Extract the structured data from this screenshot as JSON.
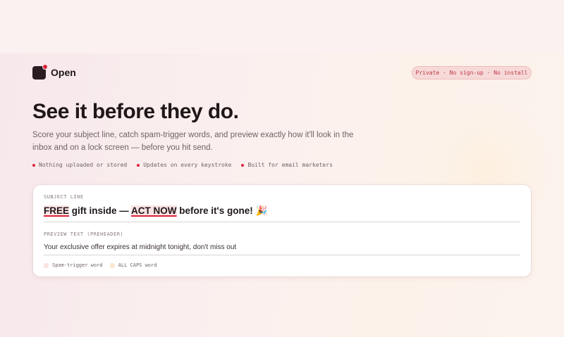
{
  "brand": {
    "name": "Open"
  },
  "badge": {
    "text": "Private · No sign-up · No install"
  },
  "hero": {
    "headline": "See it before they do.",
    "subtext": "Score your subject line, catch spam-trigger words, and preview exactly how it'll look in the inbox and on a lock screen — before you hit send."
  },
  "features": [
    "Nothing uploaded or stored",
    "Updates on every keystroke",
    "Built for email marketers"
  ],
  "form": {
    "subject_label": "SUBJECT LINE",
    "subject_parts": {
      "p1": "FREE",
      "p2": " gift inside — ",
      "p3": "ACT NOW",
      "p4": " before it's gone! 🎉"
    },
    "preview_label": "PREVIEW TEXT (PREHEADER)",
    "preview_value": "Your exclusive offer expires at midnight tonight, don't miss out"
  },
  "legend": {
    "spam": {
      "label": "Spam-trigger word",
      "color": "#fbe3e4"
    },
    "caps": {
      "label": "ALL CAPS word",
      "color": "#fbe8d2"
    }
  },
  "colors": {
    "accent": "#d8233b",
    "brand_dark": "#2a1c20"
  }
}
